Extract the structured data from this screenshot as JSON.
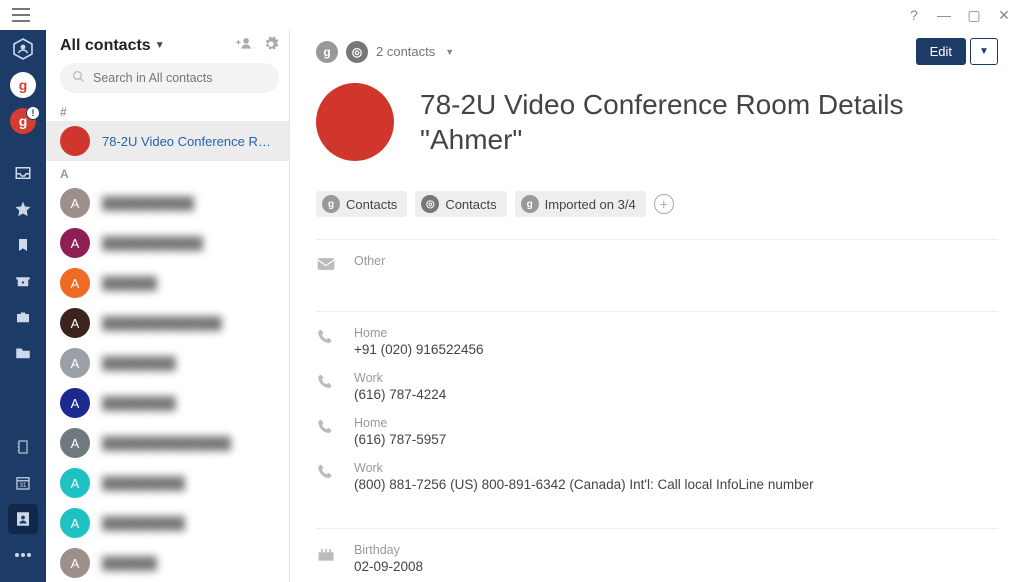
{
  "titlebar": {
    "help": "?",
    "min": "—",
    "max": "▢",
    "close": "✕"
  },
  "listpanel": {
    "title": "All contacts",
    "search_placeholder": "Search in All contacts",
    "section_hash": "#",
    "section_a": "A",
    "selected": "78-2U Video Conference Room...",
    "rows": [
      {
        "letter": "A",
        "color": "#9d8f8a"
      },
      {
        "letter": "A",
        "color": "#8d1f55"
      },
      {
        "letter": "A",
        "color": "#ef6a24"
      },
      {
        "letter": "A",
        "color": "#3a241d"
      },
      {
        "letter": "A",
        "color": "#9aa0a6"
      },
      {
        "letter": "A",
        "color": "#1c2a8f"
      },
      {
        "letter": "A",
        "color": "#6f7a80"
      },
      {
        "letter": "A",
        "color": "#1ec2c2"
      },
      {
        "letter": "A",
        "color": "#1ec2c2"
      },
      {
        "letter": "A",
        "color": "#9d8f8a"
      }
    ]
  },
  "detail": {
    "count_label": "2 contacts",
    "edit_label": "Edit",
    "title_line1": "78-2U Video Conference Room Details",
    "title_line2": "\"Ahmer\"",
    "tags": {
      "contacts1": "Contacts",
      "contacts2": "Contacts",
      "imported": "Imported on 3/4"
    },
    "email": {
      "label": "Other",
      "value": ""
    },
    "phones": [
      {
        "label": "Home",
        "value": "+91 (020) 916522456"
      },
      {
        "label": "Work",
        "value": "(616) 787-4224"
      },
      {
        "label": "Home",
        "value": "(616) 787-5957"
      },
      {
        "label": "Work",
        "value": "(800) 881-7256 (US)  800-891-6342 (Canada)  Int'l: Call local InfoLine number"
      }
    ],
    "birthday": {
      "label": "Birthday",
      "value": "02-09-2008"
    }
  }
}
